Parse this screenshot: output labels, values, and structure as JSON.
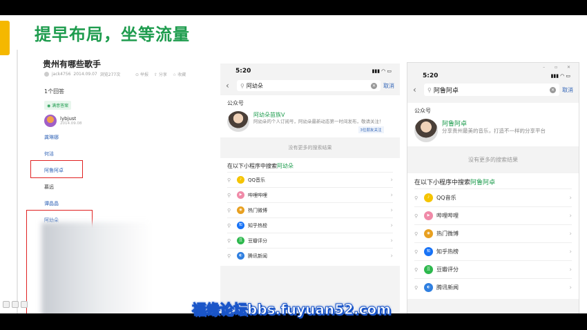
{
  "slide": {
    "title": "提早布局，坐等流量"
  },
  "qa": {
    "title": "贵州有哪些歌手",
    "author": "jack4756",
    "date": "2014.09.07",
    "views": "浏览277次",
    "actions": [
      "举报",
      "分享",
      "收藏"
    ],
    "answers_count": "1个回答",
    "badge": "满意答案",
    "user": {
      "name": "lybjust",
      "date": "2014.09.08"
    },
    "answer_items": [
      {
        "text": "龚琳娜",
        "style": "link"
      },
      {
        "text": "何洁",
        "style": "link"
      },
      {
        "text": "阿鲁阿卓",
        "style": "link"
      },
      {
        "text": "慕远",
        "style": "plain"
      },
      {
        "text": "谭晶晶",
        "style": "link"
      },
      {
        "text": "阿幼朵",
        "style": "link"
      }
    ]
  },
  "phone1": {
    "time": "5:20",
    "query": "阿幼朵",
    "cancel": "取消",
    "section_label": "公众号",
    "account": {
      "name": "阿幼朵苗族V",
      "desc": "阿幼朵的个人订阅号，阿幼朵最新动态第一时间发布，敬请关注！",
      "link": "3位朋友关注"
    },
    "no_more": "没有更多的搜索结果",
    "mp_head_prefix": "在以下小程序中搜索",
    "mp_head_key": "阿幼朵"
  },
  "phone2": {
    "time": "5:20",
    "query": "阿鲁阿卓",
    "cancel": "取消",
    "section_label": "公众号",
    "account": {
      "name": "阿鲁阿卓",
      "desc": "分享贵州最美的音乐，打造不一样的分享平台"
    },
    "no_more": "没有更多的搜索结果",
    "mp_head_prefix": "在以下小程序中搜索",
    "mp_head_key": "阿鲁阿卓"
  },
  "mini_programs": [
    {
      "name": "QQ音乐",
      "icon": "qq-music-icon",
      "color": "#f5c400"
    },
    {
      "name": "哔哩哔哩",
      "icon": "bilibili-icon",
      "color": "#f08aa8"
    },
    {
      "name": "热门微博",
      "icon": "weibo-icon",
      "color": "#e8a020"
    },
    {
      "name": "知乎热榜",
      "icon": "zhihu-icon",
      "color": "#1772f6"
    },
    {
      "name": "豆瓣评分",
      "icon": "douban-icon",
      "color": "#2db84d"
    },
    {
      "name": "腾讯新闻",
      "icon": "tencent-news-icon",
      "color": "#2f7fe0"
    }
  ],
  "watermark": "福缘论坛bbs.fuyuan52.com"
}
